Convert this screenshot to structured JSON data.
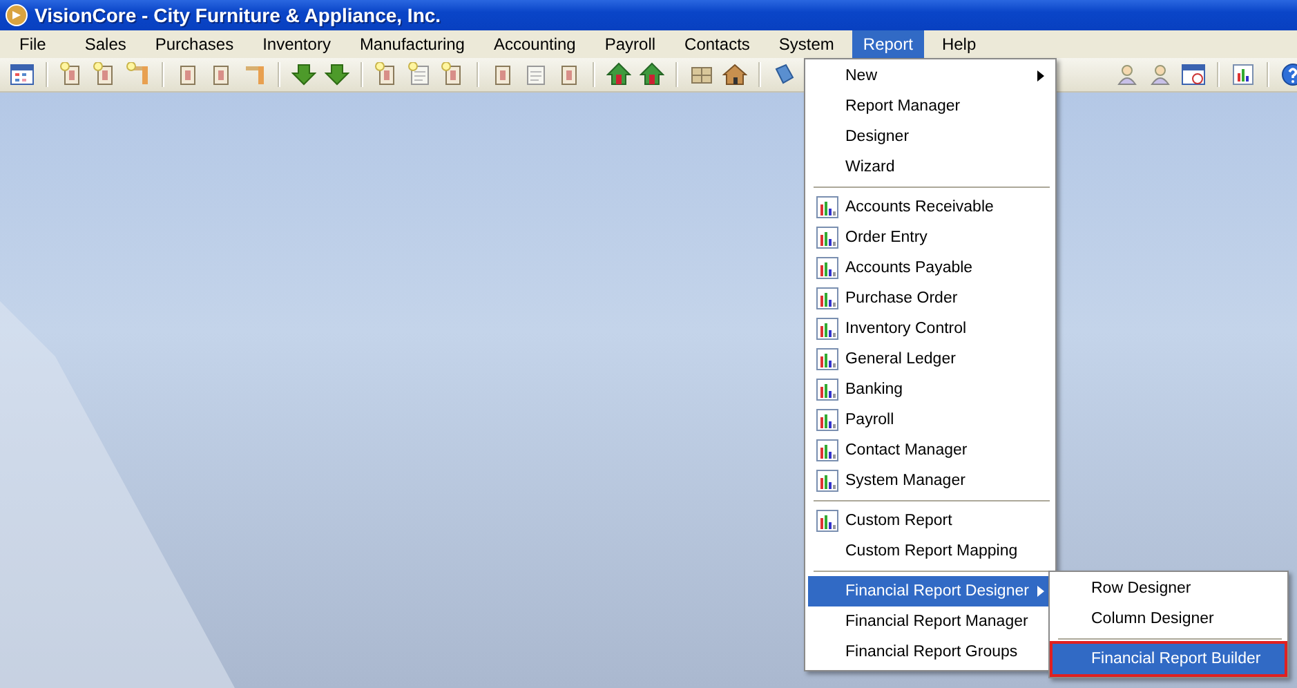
{
  "window": {
    "title": "VisionCore - City Furniture & Appliance, Inc."
  },
  "menu_bar": [
    {
      "label": "File",
      "selected": false
    },
    {
      "label": "Sales",
      "selected": false
    },
    {
      "label": "Purchases",
      "selected": false
    },
    {
      "label": "Inventory",
      "selected": false
    },
    {
      "label": "Manufacturing",
      "selected": false
    },
    {
      "label": "Accounting",
      "selected": false
    },
    {
      "label": "Payroll",
      "selected": false
    },
    {
      "label": "Contacts",
      "selected": false
    },
    {
      "label": "System",
      "selected": false
    },
    {
      "label": "Report",
      "selected": true
    },
    {
      "label": "Help",
      "selected": false
    }
  ],
  "report_menu": {
    "items": [
      {
        "kind": "submenu",
        "label": "New",
        "selected": false
      },
      {
        "kind": "plain",
        "label": "Report Manager",
        "selected": false
      },
      {
        "kind": "plain",
        "label": "Designer",
        "selected": false
      },
      {
        "kind": "plain",
        "label": "Wizard",
        "selected": false
      },
      {
        "kind": "separator"
      },
      {
        "kind": "report",
        "label": "Accounts Receivable",
        "selected": false
      },
      {
        "kind": "report",
        "label": "Order Entry",
        "selected": false
      },
      {
        "kind": "report",
        "label": "Accounts Payable",
        "selected": false
      },
      {
        "kind": "report",
        "label": "Purchase Order",
        "selected": false
      },
      {
        "kind": "report",
        "label": "Inventory Control",
        "selected": false
      },
      {
        "kind": "report",
        "label": "General Ledger",
        "selected": false
      },
      {
        "kind": "report",
        "label": "Banking",
        "selected": false
      },
      {
        "kind": "report",
        "label": "Payroll",
        "selected": false
      },
      {
        "kind": "report",
        "label": "Contact Manager",
        "selected": false
      },
      {
        "kind": "report",
        "label": "System Manager",
        "selected": false
      },
      {
        "kind": "separator"
      },
      {
        "kind": "report",
        "label": "Custom Report",
        "selected": false
      },
      {
        "kind": "plain",
        "label": "Custom Report Mapping",
        "selected": false
      },
      {
        "kind": "separator"
      },
      {
        "kind": "submenu",
        "label": "Financial Report Designer",
        "selected": true
      },
      {
        "kind": "plain",
        "label": "Financial Report Manager",
        "selected": false
      },
      {
        "kind": "plain",
        "label": "Financial Report Groups",
        "selected": false
      }
    ]
  },
  "financial_submenu": {
    "items": [
      {
        "kind": "plain",
        "label": "Row Designer",
        "selected": false,
        "outlined": false
      },
      {
        "kind": "plain",
        "label": "Column Designer",
        "selected": false,
        "outlined": false
      },
      {
        "kind": "separator"
      },
      {
        "kind": "plain",
        "label": "Financial Report Builder",
        "selected": true,
        "outlined": true
      }
    ]
  }
}
